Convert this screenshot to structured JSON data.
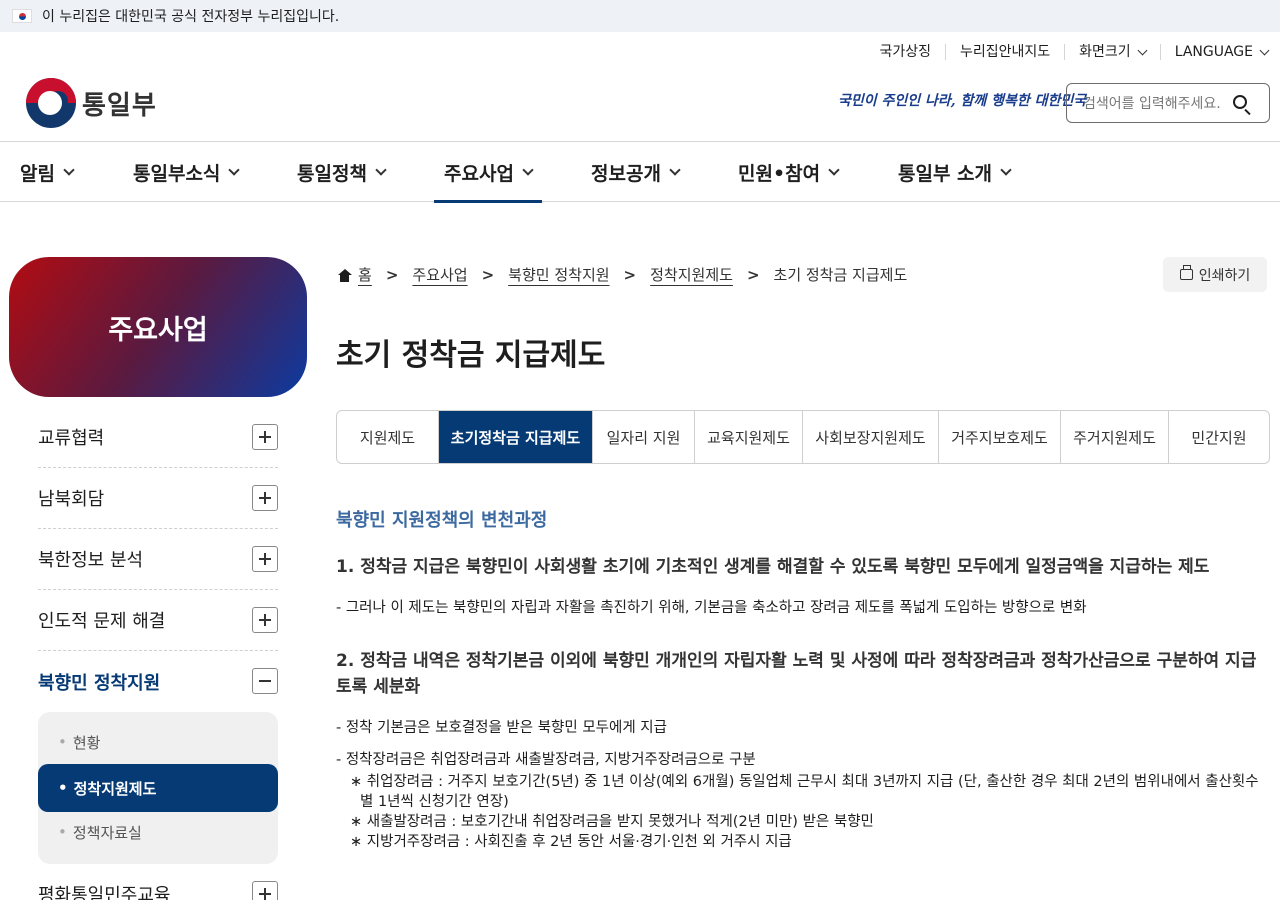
{
  "gov_banner": {
    "text": "이 누리집은 대한민국 공식 전자정부 누리집입니다."
  },
  "utility": {
    "national_symbol": "국가상징",
    "sitemap": "누리집안내지도",
    "screen_size": "화면크기",
    "language": "LANGUAGE"
  },
  "header": {
    "logo_text": "통일부",
    "slogan": "국민이 주인인 나라, 함께 행복한 대한민국",
    "search_placeholder": "검색어를 입력해주세요."
  },
  "gnb": {
    "items": [
      {
        "label": "알림"
      },
      {
        "label": "통일부소식"
      },
      {
        "label": "통일정책"
      },
      {
        "label": "주요사업"
      },
      {
        "label": "정보공개"
      },
      {
        "label": "민원•참여"
      },
      {
        "label": "통일부 소개"
      }
    ],
    "active_index": 3
  },
  "lnb": {
    "title": "주요사업",
    "items": [
      {
        "label": "교류협력"
      },
      {
        "label": "남북회담"
      },
      {
        "label": "북한정보 분석"
      },
      {
        "label": "인도적 문제 해결"
      },
      {
        "label": "북향민 정착지원"
      },
      {
        "label": "평화통일민주교육"
      }
    ],
    "sub_items": [
      {
        "label": "현황"
      },
      {
        "label": "정착지원제도"
      },
      {
        "label": "정책자료실"
      }
    ]
  },
  "breadcrumb": {
    "home": "홈",
    "items": [
      "주요사업",
      "북향민 정착지원",
      "정착지원제도"
    ],
    "current": "초기 정착금 지급제도",
    "separator": ">"
  },
  "print_label": "인쇄하기",
  "page_title": "초기 정착금 지급제도",
  "tabs": [
    {
      "label": "지원제도"
    },
    {
      "label": "초기정착금 지급제도"
    },
    {
      "label": "일자리 지원"
    },
    {
      "label": "교육지원제도"
    },
    {
      "label": "사회보장지원제도"
    },
    {
      "label": "거주지보호제도"
    },
    {
      "label": "주거지원제도"
    },
    {
      "label": "민간지원"
    }
  ],
  "content": {
    "section_title": "북향민 지원정책의 변천과정",
    "point1": "1. 정착금 지급은 북향민이 사회생활 초기에 기초적인 생계를 해결할 수 있도록 북향민 모두에게 일정금액을 지급하는 제도",
    "point1_dash": "- 그러나 이 제도는 북향민의 자립과 자활을 촉진하기 위해, 기본금을 축소하고 장려금 제도를 폭넓게 도입하는 방향으로 변화",
    "point2": "2. 정착금 내역은 정착기본금 이외에 북향민 개개인의 자립자활 노력 및 사정에 따라 정착장려금과 정착가산금으로 구분하여 지급토록 세분화",
    "point2_dash1": "- 정착 기본금은 보호결정을 받은 북향민 모두에게 지급",
    "point2_dash2": "- 정착장려금은 취업장려금과 새출발장려금, 지방거주장려금으로 구분",
    "star1": "∗ 취업장려금 : 거주지 보호기간(5년) 중 1년 이상(예외 6개월) 동일업체 근무시 최대 3년까지 지급 (단, 출산한 경우 최대 2년의 범위내에서 출산횟수별 1년씩 신청기간 연장)",
    "star2": "∗ 새출발장려금 : 보호기간내 취업장려금을 받지 못했거나 적게(2년 미만) 받은 북향민",
    "star3": "∗ 지방거주장려금 : 사회진출 후 2년 동안 서울·경기·인천 외 거주시 지급"
  }
}
